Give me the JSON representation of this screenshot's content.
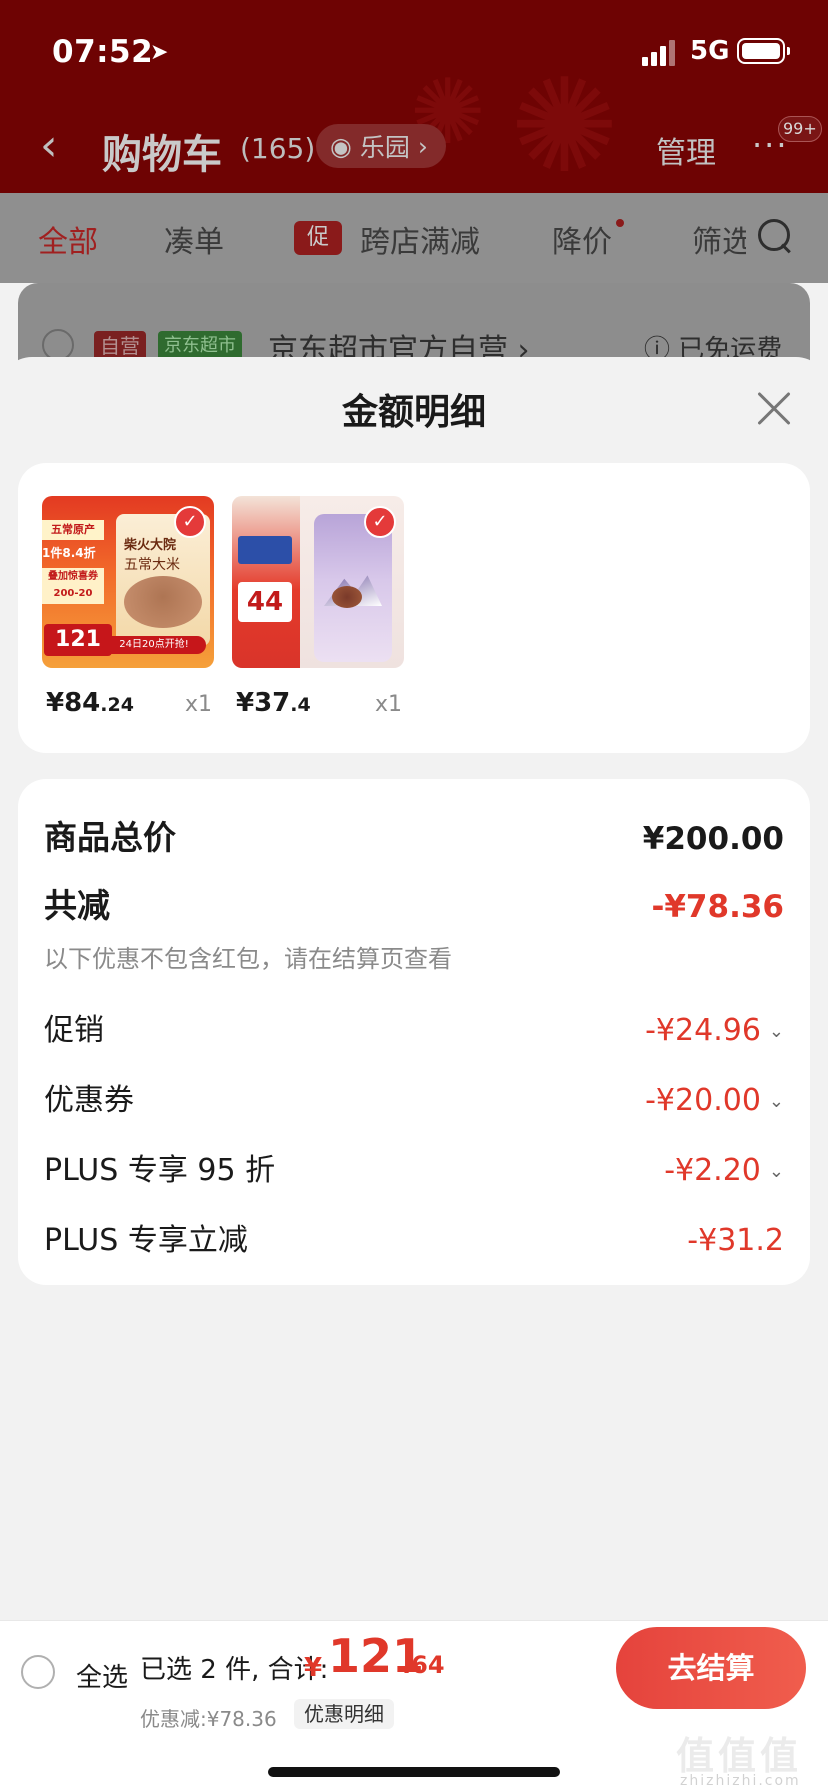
{
  "status": {
    "time": "07:52",
    "network": "5G"
  },
  "header": {
    "back_icon": "chevron-left-icon",
    "title": "购物车",
    "count": "(165)",
    "pill_label": "乐园",
    "manage": "管理",
    "more": "···",
    "badge": "99+"
  },
  "tabs": [
    {
      "label": "全部"
    },
    {
      "label": "凑单"
    },
    {
      "label": "跨店满减",
      "tag": "促"
    },
    {
      "label": "降价"
    },
    {
      "label": "筛选"
    }
  ],
  "shop": {
    "tag_self": "自营",
    "tag_market": "京东超市",
    "name": "京东超市官方自营 ›",
    "shipping": "ⓘ 已免运费"
  },
  "sheet": {
    "title": "金额明细",
    "products": [
      {
        "name_hint": "rice",
        "price_main": "¥84",
        "price_dec": ".24",
        "qty": "x1",
        "thumb": {
          "tag1": "五常原产",
          "tag2": "1件8.4折",
          "tag3": "叠加惊喜券 200-20",
          "big": "121",
          "bag_title": "柴火大院",
          "bag_sub": "五常大米",
          "bottom": "24日20点开抢!"
        }
      },
      {
        "name_hint": "oats",
        "price_main": "¥37",
        "price_dec": ".4",
        "qty": "x1",
        "thumb": {
          "big": "44"
        }
      }
    ],
    "summary": {
      "total_label": "商品总价",
      "total_value": "¥200.00",
      "reduce_label": "共减",
      "reduce_value": "-¥78.36",
      "hint": "以下优惠不包含红包，请在结算页查看",
      "items": [
        {
          "label": "促销",
          "value": "-¥24.96",
          "expandable": true
        },
        {
          "label": "优惠券",
          "value": "-¥20.00",
          "expandable": true
        },
        {
          "label": "PLUS 专享 95 折",
          "value": "-¥2.20",
          "expandable": true
        },
        {
          "label": "PLUS 专享立减",
          "value": "-¥31.2",
          "expandable": false
        }
      ]
    }
  },
  "bottom": {
    "select_all": "全选",
    "selected": "已选 2 件, 合计:",
    "currency": "¥",
    "total_main": "121",
    "total_dec": ".64",
    "discount": "优惠减:¥78.36",
    "detail": "优惠明细",
    "checkout": "去结算"
  },
  "watermark": {
    "text": "值值值",
    "sub": "zhizhizhi.com"
  },
  "colors": {
    "accent": "#e0382a",
    "header_bg": "#6e0303",
    "checkout_start": "#e5433c",
    "checkout_end": "#f05d4d"
  }
}
